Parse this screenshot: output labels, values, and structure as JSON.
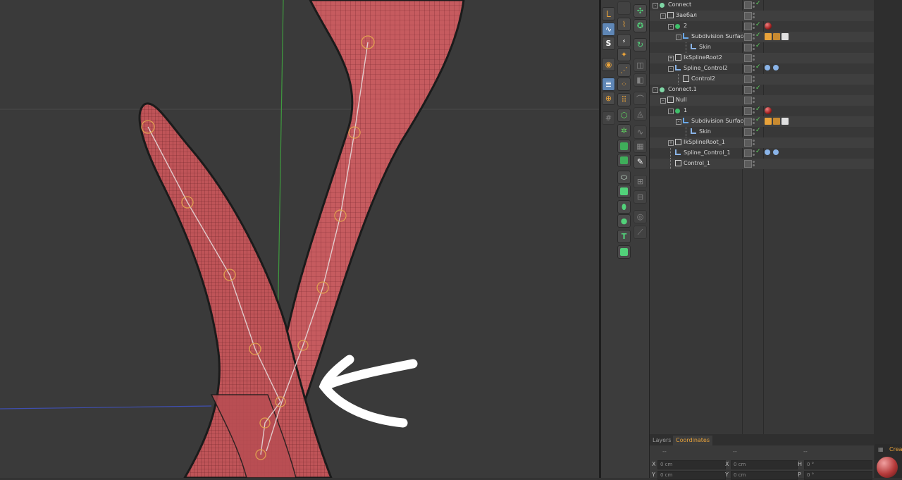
{
  "object_manager": {
    "rows": [
      {
        "label": "Connect",
        "icon": "connect-icon",
        "depth": 0,
        "fold": "-",
        "tag": null,
        "checked": true
      },
      {
        "label": "Заебал",
        "icon": "null-icon",
        "depth": 1,
        "fold": "-",
        "tag": null,
        "checked": false
      },
      {
        "label": "2",
        "icon": "sphere-icon",
        "depth": 2,
        "fold": "-",
        "tag": "material",
        "checked": true
      },
      {
        "label": "Subdivision Surface",
        "icon": "subdivision-icon",
        "depth": 3,
        "fold": "-",
        "tag": "texture",
        "checked": true
      },
      {
        "label": "Skin",
        "icon": "skin-icon",
        "depth": 4,
        "fold": "",
        "tag": null,
        "checked": true
      },
      {
        "label": "IkSplineRoot2",
        "icon": "null-icon",
        "depth": 2,
        "fold": "+",
        "tag": null,
        "checked": false
      },
      {
        "label": "Spline_Control2",
        "icon": "spline-icon",
        "depth": 2,
        "fold": "-",
        "tag": "ik",
        "checked": true
      },
      {
        "label": "Control2",
        "icon": "null-icon",
        "depth": 3,
        "fold": "",
        "tag": null,
        "checked": false
      },
      {
        "label": "Connect.1",
        "icon": "connect-icon",
        "depth": 0,
        "fold": "-",
        "tag": null,
        "checked": true
      },
      {
        "label": "Null",
        "icon": "null-icon",
        "depth": 1,
        "fold": "-",
        "tag": null,
        "checked": false
      },
      {
        "label": "1",
        "icon": "sphere-icon",
        "depth": 2,
        "fold": "-",
        "tag": "material",
        "checked": true
      },
      {
        "label": "Subdivision Surface",
        "icon": "subdivision-icon",
        "depth": 3,
        "fold": "-",
        "tag": "texture",
        "checked": true
      },
      {
        "label": "Skin",
        "icon": "skin-icon",
        "depth": 4,
        "fold": "",
        "tag": null,
        "checked": true
      },
      {
        "label": "IkSplineRoot_1",
        "icon": "null-icon",
        "depth": 2,
        "fold": "+",
        "tag": null,
        "checked": false
      },
      {
        "label": "Spline_Control_1",
        "icon": "spline-icon",
        "depth": 2,
        "fold": "",
        "tag": "ik",
        "checked": true
      },
      {
        "label": "Control_1",
        "icon": "null-icon",
        "depth": 2,
        "fold": "",
        "tag": null,
        "checked": false
      }
    ]
  },
  "attribute_tabs": [
    {
      "label": "Layers",
      "active": false
    },
    {
      "label": "Coordinates",
      "active": true
    }
  ],
  "coordinates": {
    "headers": [
      "--",
      "--",
      "--"
    ],
    "row1": {
      "x_label": "X",
      "x_val": "0 cm",
      "x2_label": "X",
      "x2_val": "0 cm",
      "h_label": "H",
      "h_val": "0 °"
    },
    "row2": {
      "y_label": "Y",
      "y_val": "0 cm",
      "y2_label": "Y",
      "y2_val": "0 cm",
      "p_label": "P",
      "p_val": "0 °"
    }
  },
  "material_panel": {
    "label": "Crea"
  },
  "viewport": {
    "mesh_color": "#c75a5e",
    "annotation_color": "#ffffff"
  },
  "toolbar": {
    "icons": [
      "axis-icon",
      "spline-pen-icon",
      "snap-icon",
      "magnet-icon",
      "layers-lock-icon",
      "workplane-icon",
      "grid-icon",
      "render-icon",
      "render-settings-icon",
      "ik-icon"
    ]
  }
}
